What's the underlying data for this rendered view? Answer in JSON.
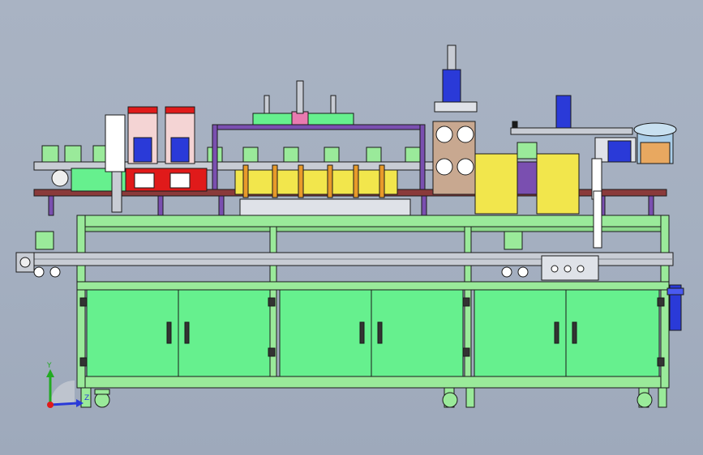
{
  "scene": {
    "colors": {
      "background_top": "#a9b3c3",
      "background_bottom": "#9ea9bb",
      "frame_green": "#9aea9a",
      "cabinet_green": "#66f08e",
      "panel_yellow": "#f2e64c",
      "deck_maroon": "#8a3a3a",
      "accent_purple": "#7a4fb0",
      "accent_red": "#e01a1a",
      "accent_orange": "#e89a2a",
      "rail_grey": "#c8ccd4",
      "motor_blue": "#2a3ad8",
      "edge_dark": "#1a1a1a"
    }
  },
  "triad": {
    "axis_y": "Y",
    "axis_z": "Z"
  }
}
